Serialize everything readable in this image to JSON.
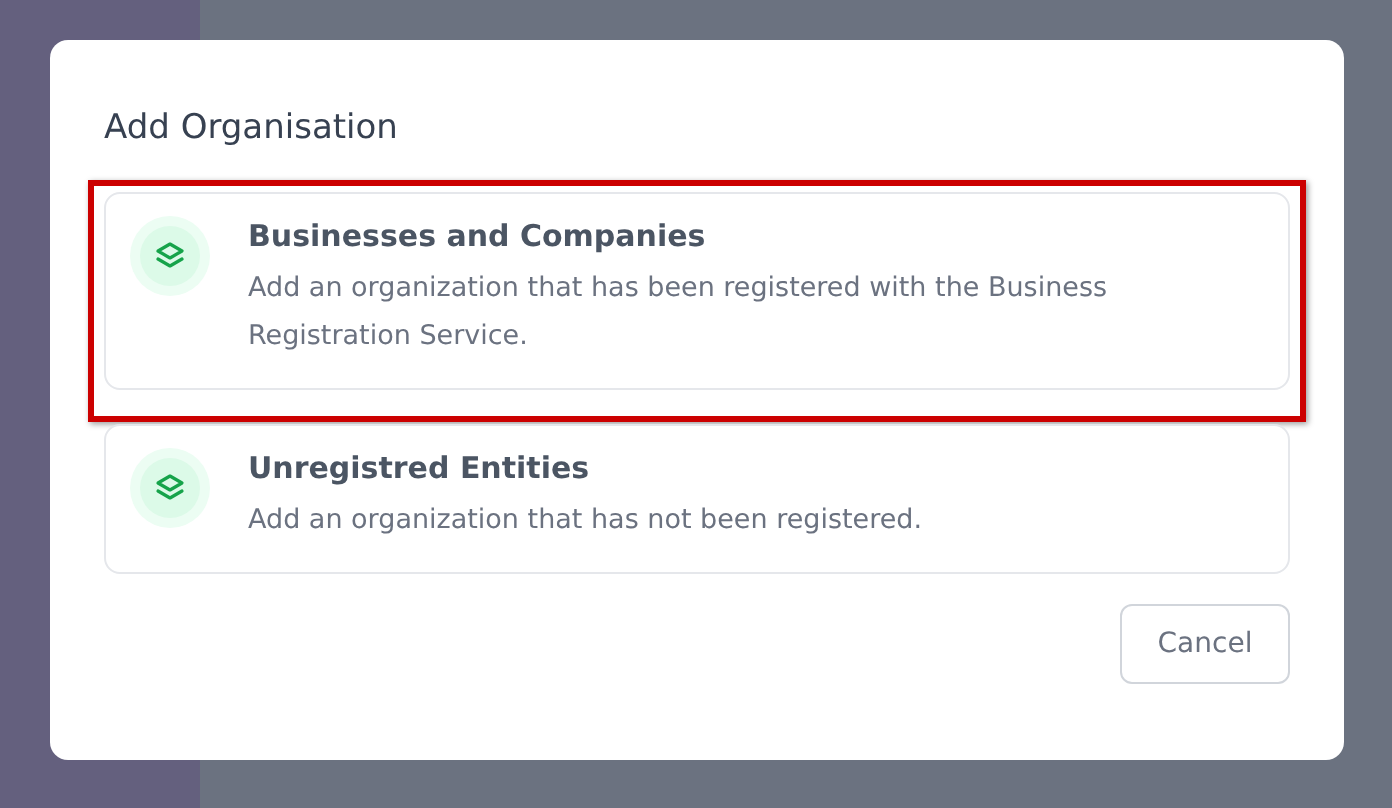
{
  "dialog": {
    "title": "Add Organisation",
    "options": [
      {
        "title": "Businesses and Companies",
        "description": "Add an organization that has been registered with the Business Registration Service.",
        "highlighted": true
      },
      {
        "title": "Unregistred Entities",
        "description": "Add an organization that has not been registered.",
        "highlighted": false
      }
    ],
    "buttons": [
      "Cancel"
    ]
  }
}
